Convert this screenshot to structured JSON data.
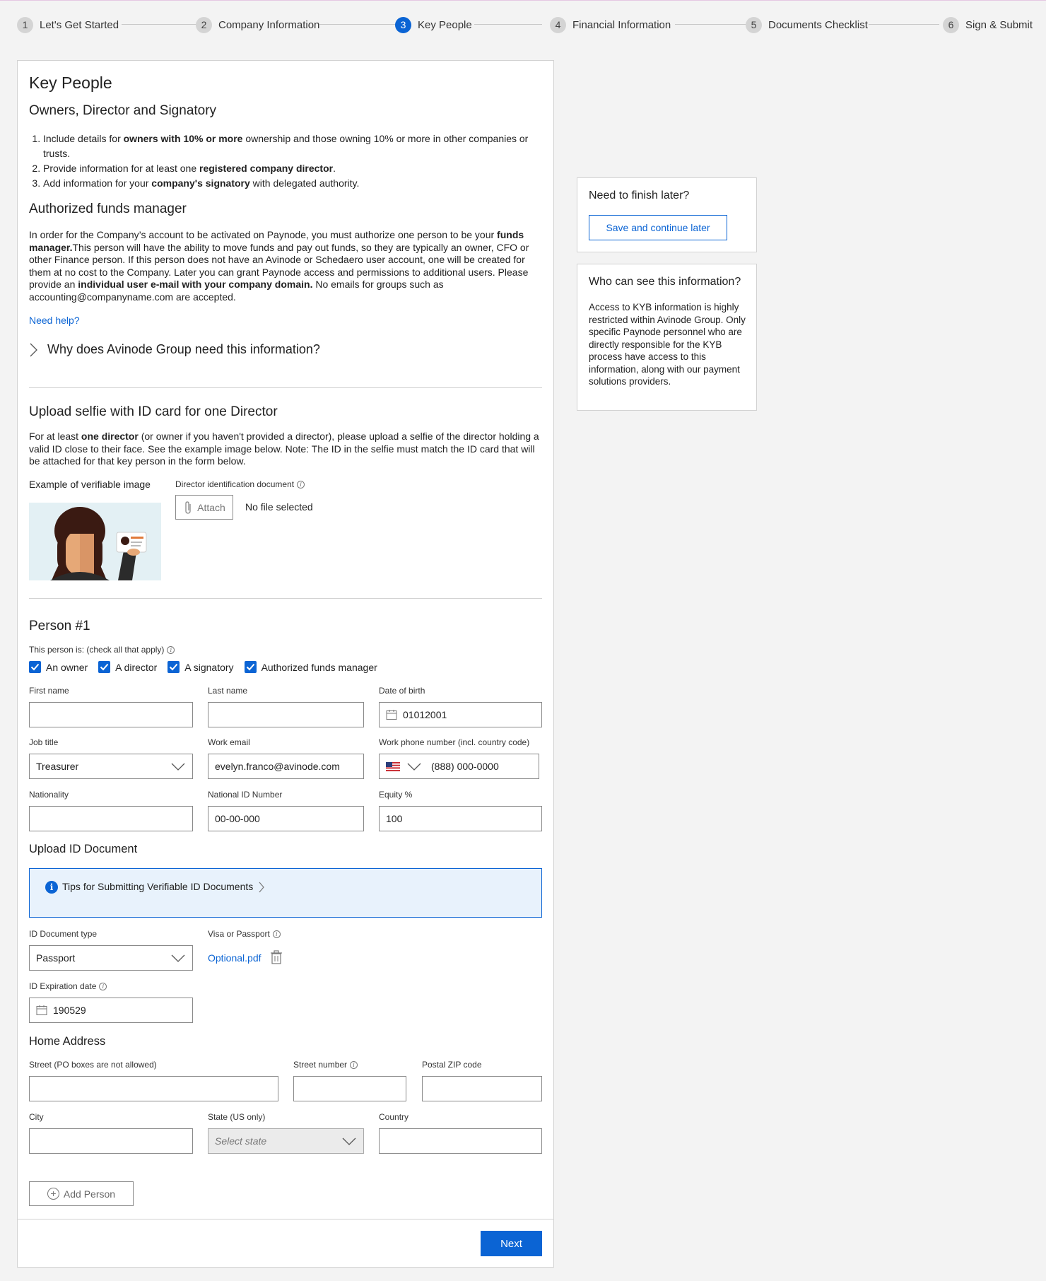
{
  "stepper": [
    {
      "num": "1",
      "label": "Let's Get Started"
    },
    {
      "num": "2",
      "label": "Company Information"
    },
    {
      "num": "3",
      "label": "Key People"
    },
    {
      "num": "4",
      "label": "Financial Information"
    },
    {
      "num": "5",
      "label": "Documents Checklist"
    },
    {
      "num": "6",
      "label": "Sign & Submit"
    }
  ],
  "colors": {
    "accent": "#0b64d4",
    "tips_bg": "#e8f2fc"
  },
  "main": {
    "title": "Key People",
    "owners_heading": "Owners, Director and Signatory",
    "list": [
      {
        "pre": "Include details for ",
        "bold": "owners with 10% or more",
        "post": " ownership and those owning 10% or more in other companies or trusts."
      },
      {
        "pre": "Provide information for at least one ",
        "bold": "registered company director",
        "post": "."
      },
      {
        "pre": "Add information for your ",
        "bold": "company's signatory",
        "post": " with delegated authority."
      }
    ],
    "funds_heading": "Authorized funds manager",
    "funds_para": {
      "p1": "In order for the Company’s account to be activated on Paynode, you must authorize one person to be your ",
      "b1": "funds manager.",
      "p2": "This person will have the ability to move funds and pay out funds, so they are typically an owner, CFO or other Finance person. If this person does not have an Avinode or Schedaero user account, one will be created for them at no cost to the Company. Later you can grant Paynode access and permissions to additional users. Please provide an ",
      "b2": "individual user e-mail with your company domain.",
      "p3": " No emails for groups such as accounting@companyname.com are accepted."
    },
    "need_help": "Need help?",
    "why_label": "Why does Avinode Group need this information?",
    "selfie_heading": "Upload selfie with ID card for one Director",
    "selfie_para": {
      "p1": "For at least ",
      "b1": "one director",
      "p2": " (or owner if you haven't provided a director), please upload a selfie of the director holding a valid ID close to their face. See the example image below. Note: The ID in the selfie must match the ID card that will be attached for that key person in the form below."
    },
    "example_label": "Example of verifiable image",
    "director_doc_label": "Director identification document",
    "attach_label": "Attach",
    "no_file": "No file selected"
  },
  "person": {
    "heading": "Person #1",
    "role_label": "This person is: (check all that apply)",
    "roles": [
      "An owner",
      "A director",
      "A signatory",
      "Authorized funds manager"
    ],
    "fields": {
      "first_name": {
        "label": "First name",
        "value": ""
      },
      "last_name": {
        "label": "Last name",
        "value": ""
      },
      "dob": {
        "label": "Date of birth",
        "value": "01012001"
      },
      "job_title": {
        "label": "Job title",
        "value": "Treasurer"
      },
      "work_email": {
        "label": "Work email",
        "value": "evelyn.franco@avinode.com"
      },
      "work_phone": {
        "label": "Work phone number (incl. country code)",
        "value": "(888) 000-0000"
      },
      "nationality": {
        "label": "Nationality",
        "value": ""
      },
      "national_id": {
        "label": "National ID Number",
        "value": "00-00-000"
      },
      "equity": {
        "label": "Equity %",
        "value": "100"
      }
    },
    "upload_heading": "Upload ID Document",
    "tips_label": "Tips for Submitting Verifiable ID Documents",
    "id_doc_type": {
      "label": "ID Document type",
      "value": "Passport"
    },
    "visa_label": "Visa or Passport",
    "file_name": "Optional.pdf",
    "id_expiration": {
      "label": "ID Expiration date",
      "value": "190529"
    },
    "address_heading": "Home Address",
    "address": {
      "street": {
        "label": "Street (PO boxes are not allowed)",
        "value": ""
      },
      "street_number": {
        "label": "Street number",
        "value": ""
      },
      "zip": {
        "label": "Postal ZIP code",
        "value": ""
      },
      "city": {
        "label": "City",
        "value": ""
      },
      "state": {
        "label": "State (US only)",
        "placeholder": "Select state"
      },
      "country": {
        "label": "Country",
        "value": ""
      }
    },
    "add_person": "Add Person"
  },
  "footer": {
    "next": "Next"
  },
  "side": {
    "finish_title": "Need to finish later?",
    "save_label": "Save and continue later",
    "who_title": "Who can see this information?",
    "who_text": "Access to KYB information is highly restricted within Avinode Group. Only specific Paynode personnel who are directly responsible for the KYB process have access to this information, along with our payment solutions providers."
  }
}
